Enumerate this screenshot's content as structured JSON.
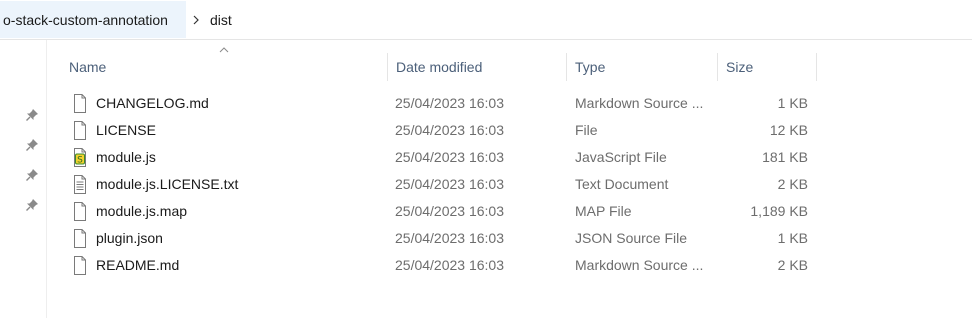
{
  "breadcrumb": {
    "parent": "o-stack-custom-annotation",
    "current": "dist"
  },
  "columns": {
    "name": "Name",
    "date": "Date modified",
    "type": "Type",
    "size": "Size"
  },
  "files": [
    {
      "name": "CHANGELOG.md",
      "date": "25/04/2023 16:03",
      "type": "Markdown Source ...",
      "size": "1 KB",
      "icon": "document-icon"
    },
    {
      "name": "LICENSE",
      "date": "25/04/2023 16:03",
      "type": "File",
      "size": "12 KB",
      "icon": "document-icon"
    },
    {
      "name": "module.js",
      "date": "25/04/2023 16:03",
      "type": "JavaScript File",
      "size": "181 KB",
      "icon": "javascript-file-icon"
    },
    {
      "name": "module.js.LICENSE.txt",
      "date": "25/04/2023 16:03",
      "type": "Text Document",
      "size": "2 KB",
      "icon": "text-file-icon"
    },
    {
      "name": "module.js.map",
      "date": "25/04/2023 16:03",
      "type": "MAP File",
      "size": "1,189 KB",
      "icon": "document-icon"
    },
    {
      "name": "plugin.json",
      "date": "25/04/2023 16:03",
      "type": "JSON Source File",
      "size": "1 KB",
      "icon": "document-icon"
    },
    {
      "name": "README.md",
      "date": "25/04/2023 16:03",
      "type": "Markdown Source ...",
      "size": "2 KB",
      "icon": "document-icon"
    }
  ]
}
